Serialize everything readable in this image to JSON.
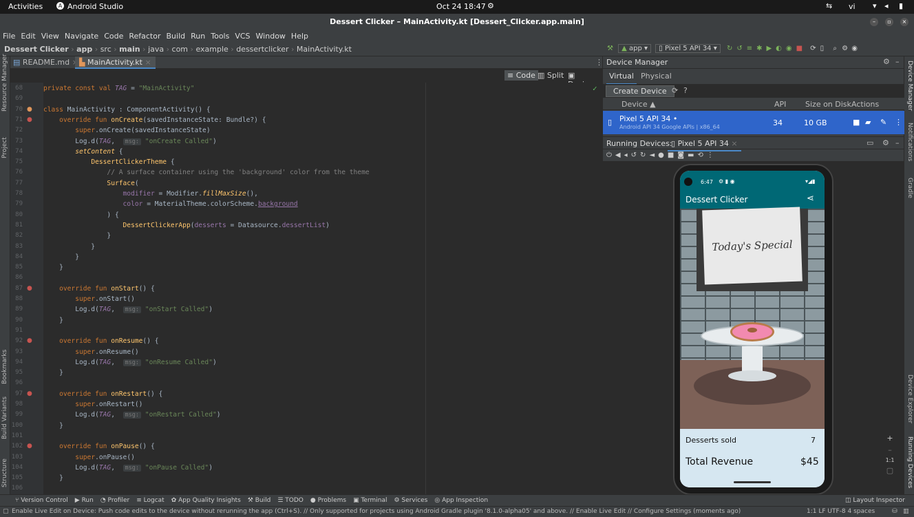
{
  "os": {
    "activities": "Activities",
    "app_name": "Android Studio",
    "clock": "Oct 24  18:47",
    "lang": "vi"
  },
  "window": {
    "title": "Dessert Clicker – MainActivity.kt [Dessert_Clicker.app.main]"
  },
  "menu": [
    "File",
    "Edit",
    "View",
    "Navigate",
    "Code",
    "Refactor",
    "Build",
    "Run",
    "Tools",
    "VCS",
    "Window",
    "Help"
  ],
  "breadcrumb": [
    "Dessert Clicker",
    "app",
    "src",
    "main",
    "java",
    "com",
    "example",
    "dessertclicker",
    "MainActivity.kt"
  ],
  "toolbar": {
    "run_config": "app",
    "device": "Pixel 5 API 34"
  },
  "tabs": [
    {
      "label": "README.md",
      "active": false
    },
    {
      "label": "MainActivity.kt",
      "active": true
    }
  ],
  "editor_modes": [
    "Code",
    "Split",
    "Design"
  ],
  "left_tools": [
    "Resource Manager",
    "Project",
    "Bookmarks",
    "Build Variants",
    "Structure"
  ],
  "right_tools": [
    "Device Manager",
    "Notifications",
    "Gradle",
    "Device Explorer",
    "Running Devices"
  ],
  "code_lines": [
    {
      "n": "68",
      "html": "<span class=\"kw\">private const val </span><span class=\"pr\"><i>TAG</i></span> = <span class=\"st\">\"MainActivity\"</span>"
    },
    {
      "n": "69",
      "html": ""
    },
    {
      "n": "70",
      "html": "<span class=\"kw\">class </span>MainActivity : ComponentActivity() {"
    },
    {
      "n": "71",
      "html": "    <span class=\"kw\">override fun </span><span class=\"fn\">onCreate</span>(savedInstanceState: Bundle?) {"
    },
    {
      "n": "72",
      "html": "        <span class=\"kw\">super</span>.onCreate(savedInstanceState)"
    },
    {
      "n": "73",
      "html": "        Log.d(<span class=\"pr\"><i>TAG</i></span>,  <span class=\"hint\">msg:</span> <span class=\"st\">\"onCreate Called\"</span>)"
    },
    {
      "n": "74",
      "html": "        <span class=\"fn\"><i>setContent</i></span> {"
    },
    {
      "n": "75",
      "html": "            <span class=\"fn\">DessertClickerTheme</span> {"
    },
    {
      "n": "76",
      "html": "                <span class=\"cm\">// A surface container using the 'background' color from the theme</span>"
    },
    {
      "n": "77",
      "html": "                <span class=\"fn\">Surface</span>("
    },
    {
      "n": "78",
      "html": "                    <span class=\"pr\">modifier</span> = Modifier.<span class=\"fn\"><i>fillMaxSize</i></span>(),"
    },
    {
      "n": "79",
      "html": "                    <span class=\"pr\">color</span> = MaterialTheme.colorScheme.<span class=\"pr\" style=\"text-decoration:underline\">background</span>"
    },
    {
      "n": "80",
      "html": "                ) {"
    },
    {
      "n": "81",
      "html": "                    <span class=\"fn\">DessertClickerApp</span>(<span class=\"pr\">desserts</span> = Datasource.<span class=\"pr\">dessertList</span>)"
    },
    {
      "n": "82",
      "html": "                }"
    },
    {
      "n": "83",
      "html": "            }"
    },
    {
      "n": "84",
      "html": "        }"
    },
    {
      "n": "85",
      "html": "    }"
    },
    {
      "n": "86",
      "html": ""
    },
    {
      "n": "87",
      "html": "    <span class=\"kw\">override fun </span><span class=\"fn\">onStart</span>() {"
    },
    {
      "n": "88",
      "html": "        <span class=\"kw\">super</span>.onStart()"
    },
    {
      "n": "89",
      "html": "        Log.d(<span class=\"pr\"><i>TAG</i></span>,  <span class=\"hint\">msg:</span> <span class=\"st\">\"onStart Called\"</span>)"
    },
    {
      "n": "90",
      "html": "    }"
    },
    {
      "n": "91",
      "html": ""
    },
    {
      "n": "92",
      "html": "    <span class=\"kw\">override fun </span><span class=\"fn\">onResume</span>() {"
    },
    {
      "n": "93",
      "html": "        <span class=\"kw\">super</span>.onResume()"
    },
    {
      "n": "94",
      "html": "        Log.d(<span class=\"pr\"><i>TAG</i></span>,  <span class=\"hint\">msg:</span> <span class=\"st\">\"onResume Called\"</span>)"
    },
    {
      "n": "95",
      "html": "    }"
    },
    {
      "n": "96",
      "html": ""
    },
    {
      "n": "97",
      "html": "    <span class=\"kw\">override fun </span><span class=\"fn\">onRestart</span>() {"
    },
    {
      "n": "98",
      "html": "        <span class=\"kw\">super</span>.onRestart()"
    },
    {
      "n": "99",
      "html": "        Log.d(<span class=\"pr\"><i>TAG</i></span>,  <span class=\"hint\">msg:</span> <span class=\"st\">\"onRestart Called\"</span>)"
    },
    {
      "n": "100",
      "html": "    }"
    },
    {
      "n": "101",
      "html": ""
    },
    {
      "n": "102",
      "html": "    <span class=\"kw\">override fun </span><span class=\"fn\">onPause</span>() {"
    },
    {
      "n": "103",
      "html": "        <span class=\"kw\">super</span>.onPause()"
    },
    {
      "n": "104",
      "html": "        Log.d(<span class=\"pr\"><i>TAG</i></span>,  <span class=\"hint\">msg:</span> <span class=\"st\">\"onPause Called\"</span>)"
    },
    {
      "n": "105",
      "html": "    }"
    },
    {
      "n": "106",
      "html": ""
    }
  ],
  "device_manager": {
    "title": "Device Manager",
    "tabs": [
      "Virtual",
      "Physical"
    ],
    "create_button": "Create Device",
    "columns": [
      "Device ▲",
      "API",
      "Size on Disk",
      "Actions"
    ],
    "device": {
      "name": "Pixel 5 API 34 •",
      "sub": "Android API 34 Google APIs | x86_64",
      "api": "34",
      "size": "10 GB"
    }
  },
  "running_devices": {
    "title": "Running Devices:",
    "tab": "Pixel 5 API 34"
  },
  "phone": {
    "time": "6:47",
    "app_title": "Dessert Clicker",
    "sign": "Today's Special",
    "desserts_label": "Desserts sold",
    "desserts_value": "7",
    "revenue_label": "Total Revenue",
    "revenue_value": "$45"
  },
  "zoom_label": "1:1",
  "bottom_tools": [
    "Version Control",
    "Run",
    "Profiler",
    "Logcat",
    "App Quality Insights",
    "Build",
    "TODO",
    "Problems",
    "Terminal",
    "Services",
    "App Inspection"
  ],
  "layout_inspector": "Layout Inspector",
  "status": {
    "message": "Enable Live Edit on Device: Push code edits to the device without rerunning the app (Ctrl+S). // Only supported for projects using Android Gradle plugin '8.1.0-alpha05' and above. // Enable Live Edit // Configure Settings (moments ago)",
    "right": "1:1  LF  UTF-8  4 spaces"
  },
  "colors": {
    "accent": "#2f65ca",
    "phone_bar": "#006875",
    "phone_panel": "#d6e7f1"
  }
}
